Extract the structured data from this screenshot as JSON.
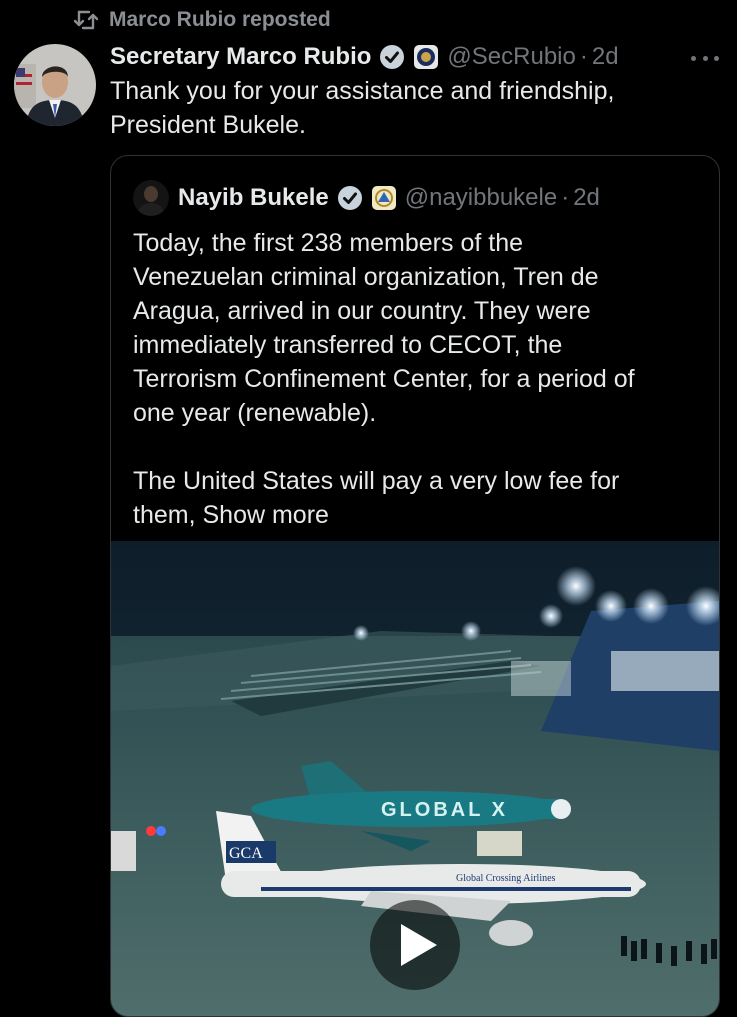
{
  "repost": {
    "label": "Marco Rubio reposted",
    "icon": "repost-icon"
  },
  "tweet": {
    "author_name": "Secretary Marco Rubio",
    "handle": "@SecRubio",
    "separator": "·",
    "time": "2d",
    "text": "Thank you for your assistance and friendship,\nPresident Bukele.",
    "badges": [
      "verified-badge-icon",
      "state-department-seal-icon"
    ],
    "more_icon": "more-dots-icon"
  },
  "quote": {
    "author_name": "Nayib Bukele",
    "handle": "@nayibbukele",
    "separator": "·",
    "time": "2d",
    "text": "Today, the first 238 members of the\nVenezuelan criminal organization, Tren de\nAragua, arrived in our country. They were\nimmediately transferred to CECOT, the\nTerrorism Confinement Center, for a period of\none year (renewable).\n\nThe United States will pay a very low fee for\nthem, ",
    "show_more": "Show more",
    "badges": [
      "verified-badge-icon",
      "el-salvador-seal-icon"
    ]
  },
  "media": {
    "type": "video",
    "play_icon": "play-icon",
    "plane1_livery": "GLOBAL X",
    "plane2_tail": "GCA",
    "plane2_livery": "Global Crossing Airlines"
  },
  "colors": {
    "background": "#000000",
    "text": "#e7e9ea",
    "muted": "#71767b",
    "verified": "#1d9bf0",
    "border": "#2f3336"
  }
}
